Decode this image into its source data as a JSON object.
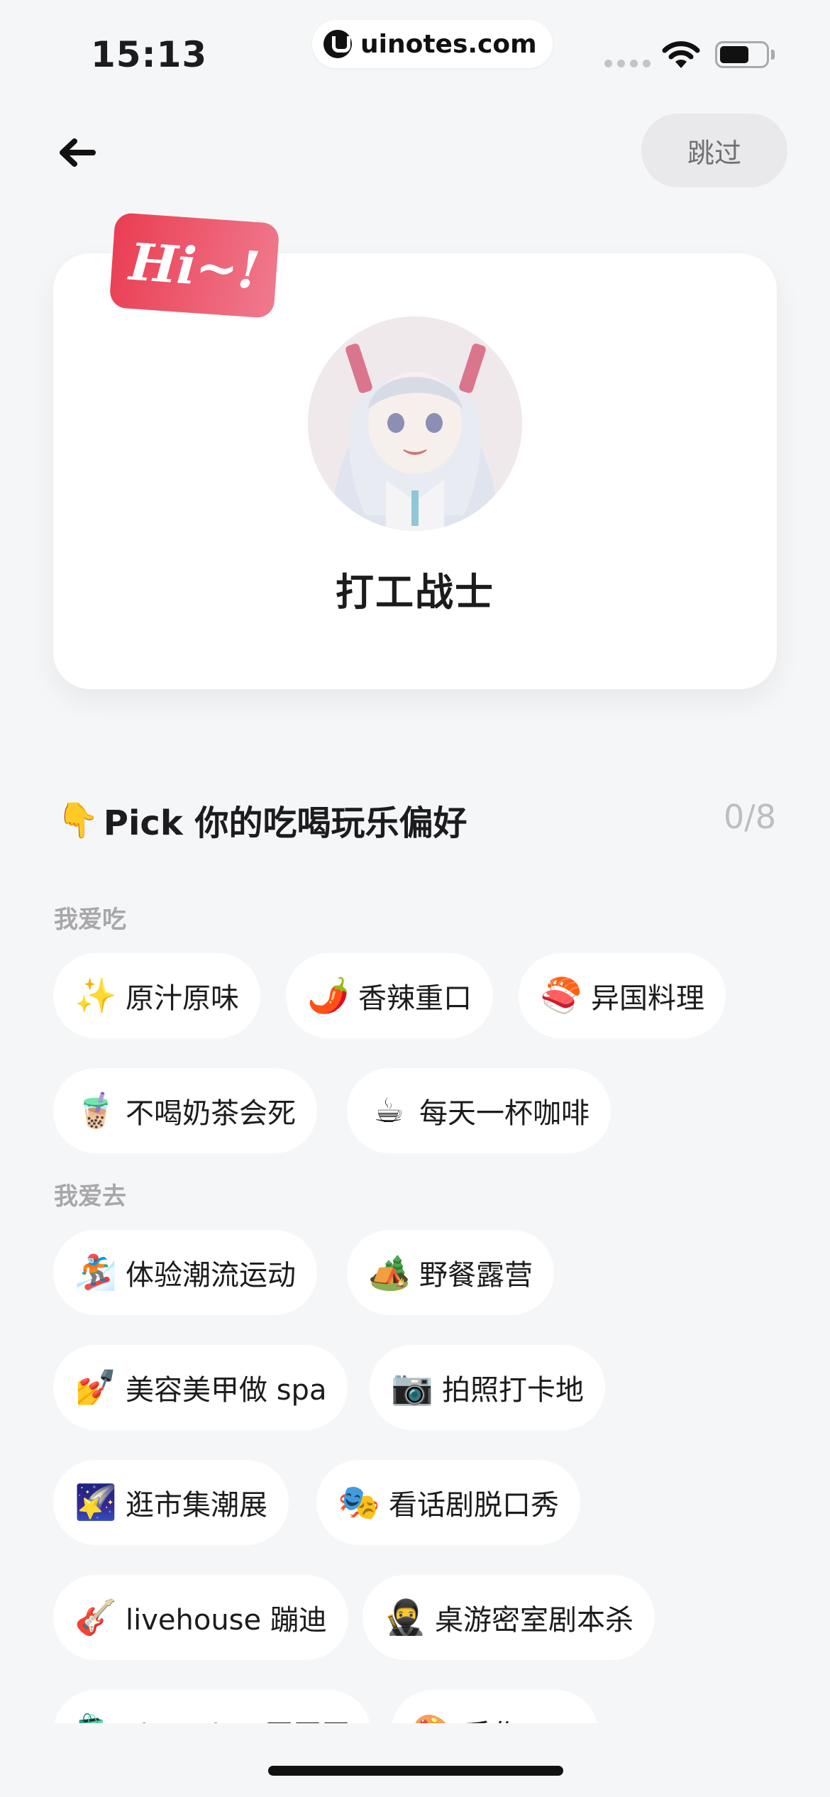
{
  "status_bar": {
    "time": "15:13",
    "watermark": "uinotes.com"
  },
  "nav": {
    "back_icon": "arrow-left-icon",
    "skip_label": "跳过"
  },
  "profile": {
    "badge_text": "Hi~!",
    "nickname": "打工战士"
  },
  "preferences": {
    "title_emoji": "👇",
    "title": "Pick 你的吃喝玩乐偏好",
    "counter": "0/8",
    "groups": [
      {
        "label": "我爱吃",
        "chips": [
          {
            "icon": "✨",
            "label": "原汁原味"
          },
          {
            "icon": "🌶️",
            "label": "香辣重口"
          },
          {
            "icon": "🍣",
            "label": "异国料理"
          },
          {
            "icon": "🧋",
            "label": "不喝奶茶会死"
          },
          {
            "icon": "☕",
            "label": "每天一杯咖啡"
          }
        ]
      },
      {
        "label": "我爱去",
        "chips": [
          {
            "icon": "🏂",
            "label": "体验潮流运动"
          },
          {
            "icon": "🏕️",
            "label": "野餐露营"
          },
          {
            "icon": "💅",
            "label": "美容美甲做 spa"
          },
          {
            "icon": "📷",
            "label": "拍照打卡地"
          },
          {
            "icon": "🌠",
            "label": "逛市集潮展"
          },
          {
            "icon": "🎭",
            "label": "看话剧脱口秀"
          },
          {
            "icon": "🎸",
            "label": "livehouse 蹦迪"
          },
          {
            "icon": "🥷",
            "label": "桌游密室剧本杀"
          },
          {
            "icon": "🛍️",
            "label": "shopping 买买买"
          },
          {
            "icon": "🎨",
            "label": "手作 DIY"
          }
        ]
      }
    ]
  },
  "colors": {
    "background": "#f5f6f7",
    "badge": "#ea3d52",
    "chip": "#ffffff",
    "muted": "#a7a7ac"
  }
}
